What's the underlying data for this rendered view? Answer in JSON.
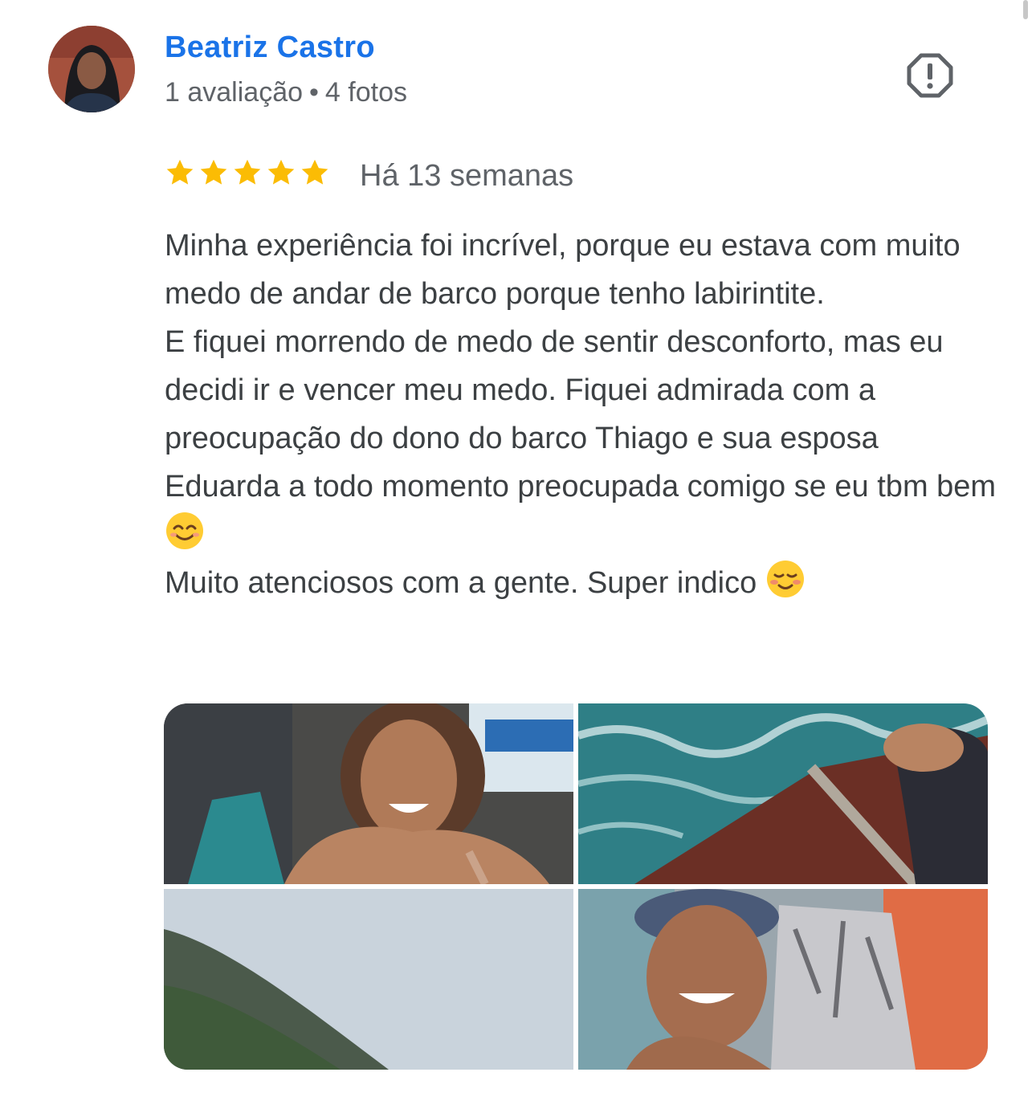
{
  "reviewer": {
    "name": "Beatriz Castro",
    "reviews_count": "1 avaliação",
    "photos_count": "4 fotos"
  },
  "review": {
    "rating": 5,
    "max_rating": 5,
    "time_ago": "Há 13 semanas",
    "text_lines": [
      "Minha experiência foi incrível, porque eu estava com muito medo de andar de barco porque tenho labirintite.",
      "E fiquei morrendo de medo de sentir desconforto, mas eu decidi ir e vencer meu medo. Fiquei admirada com a preocupação do dono do barco Thiago e sua esposa Eduarda a todo momento preocupada comigo se eu tbm bem",
      "Muito atenciosos com a gente. Super indico"
    ]
  },
  "icons": {
    "report": "report-flag-icon",
    "star": "star-icon",
    "emoji_smile": "smiling-face-emoji",
    "emoji_blush": "smiling-face-blush-emoji"
  },
  "colors": {
    "name": "#1a73e8",
    "star": "#fbbc04",
    "secondary_text": "#5f6368",
    "body_text": "#3c4043"
  },
  "photos": [
    {
      "name": "photo-selfie-group"
    },
    {
      "name": "photo-sea-boat-deck"
    },
    {
      "name": "photo-mountain-sky"
    },
    {
      "name": "photo-selfie-cap"
    }
  ]
}
